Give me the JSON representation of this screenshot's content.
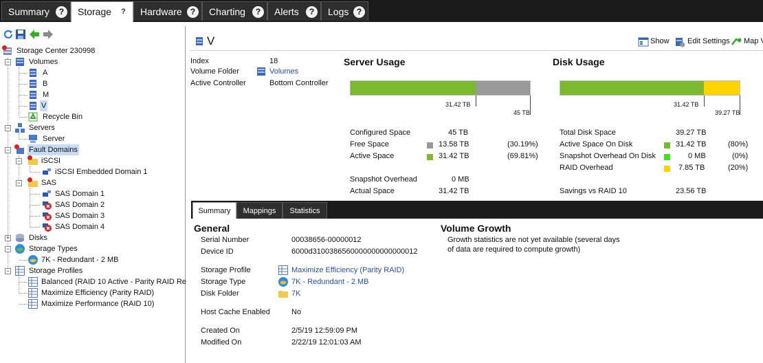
{
  "top_tabs": [
    {
      "label": "Summary",
      "active": false
    },
    {
      "label": "Storage",
      "active": true
    },
    {
      "label": "Hardware",
      "active": false
    },
    {
      "label": "Charting",
      "active": false
    },
    {
      "label": "Alerts",
      "active": false
    },
    {
      "label": "Logs",
      "active": false
    }
  ],
  "help_glyph": "?",
  "toolbar": {
    "icons": [
      "refresh-icon",
      "save-icon",
      "back-arrow-icon",
      "forward-arrow-icon"
    ]
  },
  "tree": {
    "root": "Storage Center 230998",
    "volumes": "Volumes",
    "volume_items": [
      "A",
      "B",
      "M",
      "V"
    ],
    "recycle_bin": "Recycle Bin",
    "servers": "Servers",
    "server": "Server",
    "fault_domains": "Fault Domains",
    "iscsi": "iSCSI",
    "iscsi_embedded": "iSCSI Embedded Domain 1",
    "sas": "SAS",
    "sas_domains": [
      "SAS Domain 1",
      "SAS Domain 2",
      "SAS Domain 3",
      "SAS Domain 4"
    ],
    "disks": "Disks",
    "storage_types": "Storage Types",
    "storage_type_item": "7K - Redundant - 2 MB",
    "storage_profiles": "Storage Profiles",
    "profile_items": [
      "Balanced (RAID 10 Active - Parity RAID Re",
      "Maximize Efficiency (Parity RAID)",
      "Maximize Performance (RAID 10)"
    ]
  },
  "header": {
    "title": "V",
    "show_label": "Show",
    "edit_settings_label": "Edit Settings",
    "map_label": "Map V"
  },
  "info": {
    "index_label": "Index",
    "index_value": "18",
    "folder_label": "Volume Folder",
    "folder_value": "Volumes",
    "controller_label": "Active Controller",
    "controller_value": "Bottom Controller"
  },
  "server_usage": {
    "title": "Server Usage",
    "used_fraction": 0.6982,
    "used_label": "31.42 TB",
    "total_label": "45 TB",
    "used_color": "#7cb82f",
    "free_color": "#9a9a9a",
    "rows": [
      {
        "label": "Configured Space",
        "value": "45 TB",
        "pct": "",
        "color": ""
      },
      {
        "label": "Free Space",
        "value": "13.58 TB",
        "pct": "(30.19%)",
        "color": "#9a9a9a"
      },
      {
        "label": "Active Space",
        "value": "31.42 TB",
        "pct": "(69.81%)",
        "color": "#7cb82f"
      },
      {
        "label": "Snapshot Overhead",
        "value": "0 MB",
        "pct": "",
        "color": ""
      },
      {
        "label": "Actual Space",
        "value": "31.42 TB",
        "pct": "",
        "color": ""
      }
    ]
  },
  "disk_usage": {
    "title": "Disk Usage",
    "used_fraction": 0.8001,
    "used_label": "31.42 TB",
    "total_label": "39.27 TB",
    "used_color": "#7cb82f",
    "raid_color": "#ffd400",
    "rows": [
      {
        "label": "Total Disk Space",
        "value": "39.27 TB",
        "pct": "",
        "color": ""
      },
      {
        "label": "Active Space On Disk",
        "value": "31.42 TB",
        "pct": "(80%)",
        "color": "#7cb82f"
      },
      {
        "label": "Snapshot Overhead On Disk",
        "value": "0 MB",
        "pct": "(0%)",
        "color": "#44dd22"
      },
      {
        "label": "RAID Overhead",
        "value": "7.85 TB",
        "pct": "(20%)",
        "color": "#ffd400"
      },
      {
        "label": "Savings vs RAID 10",
        "value": "23.56 TB",
        "pct": "",
        "color": ""
      }
    ]
  },
  "bottom_tabs": [
    {
      "label": "Summary",
      "active": true
    },
    {
      "label": "Mappings",
      "active": false
    },
    {
      "label": "Statistics",
      "active": false
    }
  ],
  "general": {
    "title": "General",
    "serial_label": "Serial Number",
    "serial_value": "00038656-00000012",
    "device_label": "Device ID",
    "device_value": "6000d3100386560000000000000012",
    "profile_label": "Storage Profile",
    "profile_value": "Maximize Efficiency (Parity RAID)",
    "type_label": "Storage Type",
    "type_value": "7K - Redundant - 2 MB",
    "disk_folder_label": "Disk Folder",
    "disk_folder_value": "7K",
    "cache_label": "Host Cache Enabled",
    "cache_value": "No",
    "created_label": "Created On",
    "created_value": "2/5/19 12:59:09 PM",
    "modified_label": "Modified On",
    "modified_value": "2/22/19 12:01:03 AM"
  },
  "growth": {
    "title": "Volume Growth",
    "line1": "Growth statistics are not yet available (several days",
    "line2": "of data are required to compute growth)"
  }
}
